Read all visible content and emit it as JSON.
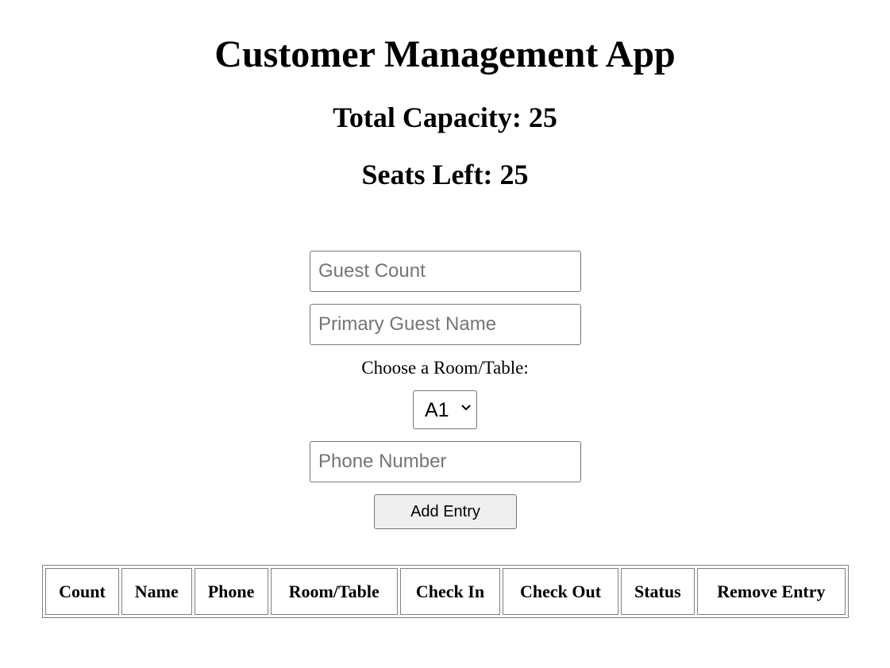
{
  "header": {
    "title": "Customer Management App",
    "total_capacity": "Total Capacity: 25",
    "seats_left": "Seats Left: 25"
  },
  "form": {
    "guest_count_placeholder": "Guest Count",
    "guest_name_placeholder": "Primary Guest Name",
    "room_label": "Choose a Room/Table:",
    "room_selected": "A1",
    "phone_placeholder": "Phone Number",
    "add_button_label": "Add Entry"
  },
  "table": {
    "columns": [
      "Count",
      "Name",
      "Phone",
      "Room/Table",
      "Check In",
      "Check Out",
      "Status",
      "Remove Entry"
    ],
    "rows": []
  },
  "colors": {
    "border": "#767676",
    "button_bg": "#efefef",
    "placeholder": "#757575"
  }
}
